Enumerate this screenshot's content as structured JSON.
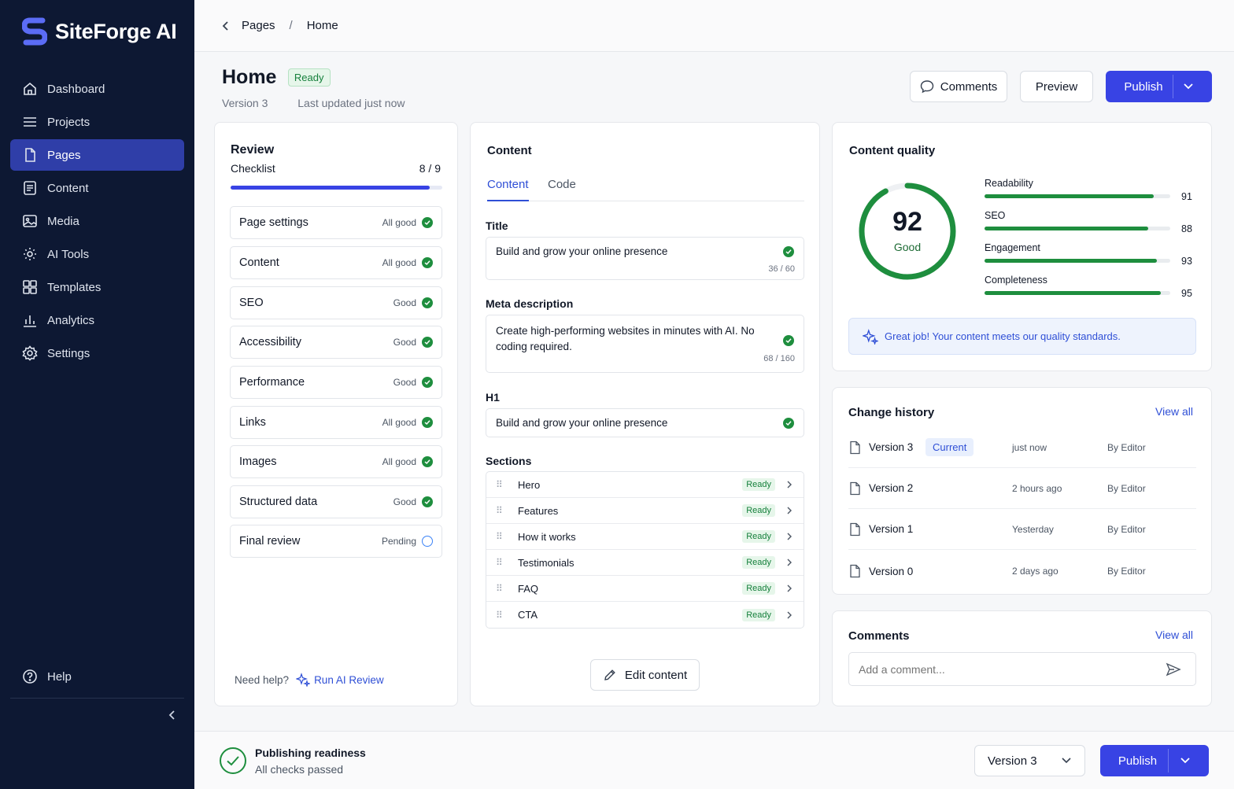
{
  "app": {
    "name": "SiteForge AI"
  },
  "sidebar": {
    "items": [
      {
        "label": "Dashboard",
        "icon": "home-icon"
      },
      {
        "label": "Projects",
        "icon": "list-icon"
      },
      {
        "label": "Pages",
        "icon": "page-icon",
        "active": true
      },
      {
        "label": "Content",
        "icon": "document-icon"
      },
      {
        "label": "Media",
        "icon": "image-icon"
      },
      {
        "label": "AI Tools",
        "icon": "ai-gear-icon"
      },
      {
        "label": "Templates",
        "icon": "grid-icon"
      },
      {
        "label": "Analytics",
        "icon": "bar-chart-icon"
      },
      {
        "label": "Settings",
        "icon": "gear-icon"
      }
    ],
    "help_label": "Help"
  },
  "breadcrumb": {
    "parent": "Pages",
    "separator": "/",
    "current": "Home"
  },
  "page": {
    "title": "Home",
    "status": "Ready",
    "version": "Version 3",
    "updated": "Last updated just now"
  },
  "toolbar": {
    "comments_label": "Comments",
    "preview_label": "Preview",
    "publish_label": "Publish"
  },
  "review": {
    "title": "Review",
    "checklist_label": "Checklist",
    "progress_text": "8 / 9",
    "progress_fraction": 0.94,
    "items": [
      {
        "label": "Page settings",
        "status": "All good",
        "state": "ok"
      },
      {
        "label": "Content",
        "status": "All good",
        "state": "ok"
      },
      {
        "label": "SEO",
        "status": "Good",
        "state": "ok"
      },
      {
        "label": "Accessibility",
        "status": "Good",
        "state": "ok"
      },
      {
        "label": "Performance",
        "status": "Good",
        "state": "ok"
      },
      {
        "label": "Links",
        "status": "All good",
        "state": "ok"
      },
      {
        "label": "Images",
        "status": "All good",
        "state": "ok"
      },
      {
        "label": "Structured data",
        "status": "Good",
        "state": "ok"
      },
      {
        "label": "Final review",
        "status": "Pending",
        "state": "pending"
      }
    ],
    "help_text": "Need help?",
    "ai_review_label": "Run AI Review"
  },
  "content": {
    "title": "Content",
    "tabs": [
      "Content",
      "Code"
    ],
    "title_field": {
      "label": "Title",
      "value": "Build and grow your online presence",
      "count": "36 / 60"
    },
    "meta_field": {
      "label": "Meta description",
      "value": "Create high-performing websites in minutes with AI. No coding required.",
      "count": "68 / 160"
    },
    "h1_field": {
      "label": "H1",
      "value": "Build and grow your online presence"
    },
    "sections_label": "Sections",
    "sections": [
      {
        "name": "Hero",
        "status": "Ready"
      },
      {
        "name": "Features",
        "status": "Ready"
      },
      {
        "name": "How it works",
        "status": "Ready"
      },
      {
        "name": "Testimonials",
        "status": "Ready"
      },
      {
        "name": "FAQ",
        "status": "Ready"
      },
      {
        "name": "CTA",
        "status": "Ready"
      }
    ],
    "edit_label": "Edit content"
  },
  "quality": {
    "title": "Content quality",
    "score": "92",
    "score_fraction": 0.92,
    "score_label": "Good",
    "metrics": [
      {
        "label": "Readability",
        "value": 91
      },
      {
        "label": "SEO",
        "value": 88
      },
      {
        "label": "Engagement",
        "value": 93
      },
      {
        "label": "Completeness",
        "value": 95
      }
    ],
    "message": "Great job! Your content meets our quality standards."
  },
  "history": {
    "title": "Change history",
    "view_all": "View all",
    "rows": [
      {
        "version": "Version 3",
        "badge": "Current",
        "time": "just now",
        "by": "By Editor"
      },
      {
        "version": "Version 2",
        "badge": "",
        "time": "2 hours ago",
        "by": "By Editor"
      },
      {
        "version": "Version 1",
        "badge": "",
        "time": "Yesterday",
        "by": "By Editor"
      },
      {
        "version": "Version 0",
        "badge": "",
        "time": "2 days ago",
        "by": "By Editor"
      }
    ]
  },
  "comments": {
    "title": "Comments",
    "view_all": "View all",
    "placeholder": "Add a comment..."
  },
  "footer": {
    "readiness_title": "Publishing readiness",
    "readiness_sub": "All checks passed",
    "version_select": "Version 3",
    "publish_label": "Publish"
  },
  "colors": {
    "accent": "#3843e4",
    "sidebar": "#0d1833",
    "success": "#1e8e3e"
  }
}
